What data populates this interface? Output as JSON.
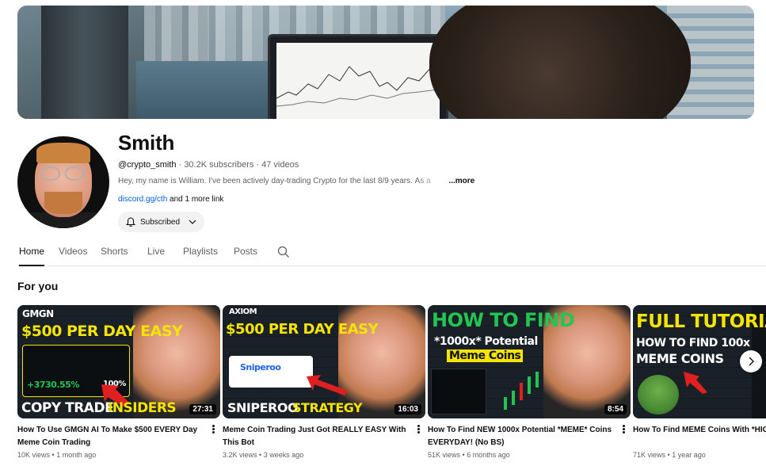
{
  "channel": {
    "name": "Smith",
    "handle": "@crypto_smith",
    "subscribers": "30.2K subscribers",
    "videos_count": "47 videos",
    "separator": " · ",
    "description": "Hey, my name is William. I've been actively day-trading Crypto for the last 8/9 years.",
    "description_cut": "As a",
    "more_label": "...more",
    "link": "discord.gg/cth",
    "more_links": "and 1 more link",
    "subscribe_label": "Subscribed",
    "icons": {
      "bell": "bell-icon",
      "chevron": "chevron-down-icon"
    }
  },
  "tabs": [
    {
      "label": "Home",
      "active": true
    },
    {
      "label": "Videos"
    },
    {
      "label": "Shorts"
    },
    {
      "label": "Live"
    },
    {
      "label": "Playlists"
    },
    {
      "label": "Posts"
    }
  ],
  "section": {
    "title": "For you"
  },
  "videos": [
    {
      "title": "How To Use GMGN AI To Make $500 EVERY Day Meme Coin Trading",
      "views": "10K views",
      "age": "1 month ago",
      "duration": "27:31",
      "thumb": {
        "brand": "GMGN",
        "headline": "$500 PER DAY EASY",
        "footer_a": "COPY TRADE",
        "footer_b": "INSIDERS",
        "stat": "+3730.55%",
        "stat2": "100%"
      }
    },
    {
      "title": "Meme Coin Trading Just Got REALLY EASY With This Bot",
      "views": "3.2K views",
      "age": "3 weeks ago",
      "duration": "16:03",
      "thumb": {
        "brand": "AXIOM",
        "headline": "$500 PER DAY EASY",
        "footer_a": "SNIPEROO",
        "footer_b": "STRATEGY",
        "card": "Sniperoo"
      }
    },
    {
      "title": "How To Find NEW 1000x Potential *MEME* Coins EVERYDAY! (No BS)",
      "views": "51K views",
      "age": "6 months ago",
      "duration": "8:54",
      "thumb": {
        "headline": "HOW TO FIND",
        "sub": "*1000x* Potential",
        "tag": "Meme Coins"
      }
    },
    {
      "title": "How To Find MEME Coins With *HIGH* Potential Early FULL Beginners Guide",
      "views": "71K views",
      "age": "1 year ago",
      "duration": "",
      "thumb": {
        "headline": "FULL TUTORIAL",
        "sub": "HOW TO FIND 100x",
        "tag": "MEME COINS"
      }
    }
  ],
  "colors": {
    "accent_link": "#065fd4",
    "green": "#23c552",
    "yellow": "#f5e400",
    "text_secondary": "#606060"
  }
}
